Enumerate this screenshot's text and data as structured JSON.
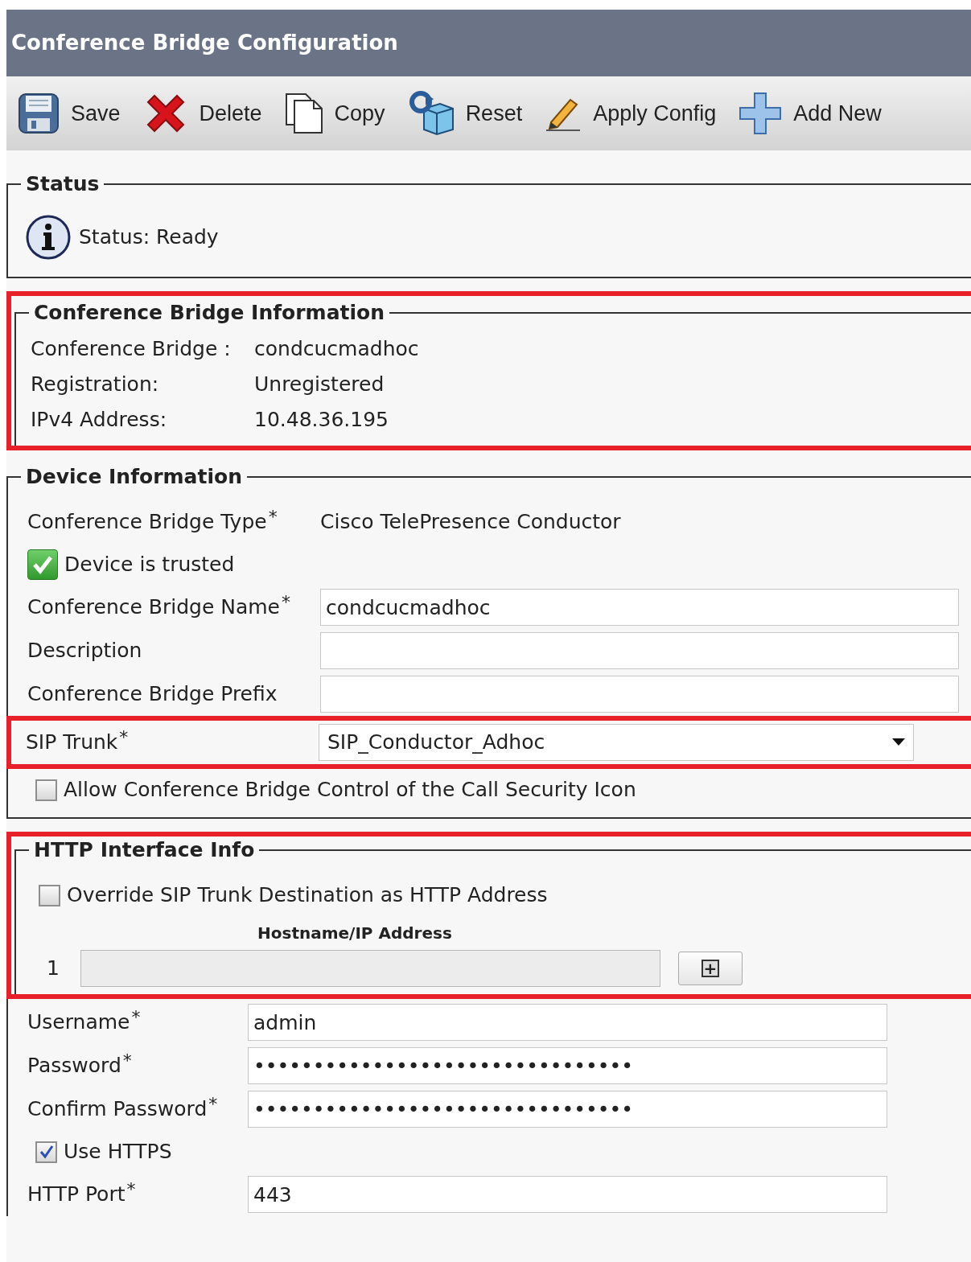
{
  "window": {
    "title": "Conference Bridge Configuration"
  },
  "toolbar": [
    {
      "kind": "save",
      "label": "Save"
    },
    {
      "kind": "delete",
      "label": "Delete"
    },
    {
      "kind": "copy",
      "label": "Copy"
    },
    {
      "kind": "reset",
      "label": "Reset"
    },
    {
      "kind": "apply",
      "label": "Apply Config"
    },
    {
      "kind": "add",
      "label": "Add New"
    }
  ],
  "status": {
    "legend": "Status",
    "text": "Status: Ready"
  },
  "bridge_info": {
    "legend": "Conference Bridge Information",
    "highlighted": true,
    "rows": [
      {
        "label": "Conference Bridge :",
        "value": "condcucmadhoc"
      },
      {
        "label": "Registration:",
        "value": "Unregistered"
      },
      {
        "label": "IPv4 Address:",
        "value": "10.48.36.195"
      }
    ]
  },
  "device_info": {
    "legend": "Device Information",
    "fields": [
      {
        "kind": "static",
        "label": "Conference Bridge Type",
        "required_mark": "*",
        "value": "Cisco TelePresence Conductor"
      },
      {
        "kind": "flag",
        "label": "Device is trusted",
        "checked": true
      },
      {
        "kind": "text",
        "label": "Conference Bridge Name",
        "required_mark": "*",
        "value": "condcucmadhoc"
      },
      {
        "kind": "text",
        "label": "Description"
      },
      {
        "kind": "text",
        "label": "Conference Bridge Prefix"
      },
      {
        "kind": "select",
        "label": "SIP Trunk",
        "required_mark": "*",
        "value": "SIP_Conductor_Adhoc",
        "highlighted": true
      },
      {
        "kind": "checkbox",
        "label": "Allow Conference Bridge Control of the Call Security Icon",
        "checked": false
      }
    ]
  },
  "http_info": {
    "legend": "HTTP Interface Info",
    "highlighted": true,
    "override": {
      "label": "Override SIP Trunk Destination as HTTP Address",
      "checked": false
    },
    "column_header": "Hostname/IP Address",
    "address_rows": [
      {
        "index": "1",
        "disabled": true,
        "button": "+"
      }
    ],
    "fields": [
      {
        "kind": "text",
        "label": "Username",
        "required_mark": "*",
        "value": "admin"
      },
      {
        "kind": "text",
        "label": "Password",
        "required_mark": "*",
        "value": "••••••••••••••••••••••••••••••••"
      },
      {
        "kind": "text",
        "label": "Confirm Password",
        "required_mark": "*",
        "value": "••••••••••••••••••••••••••••••••"
      },
      {
        "kind": "checkbox",
        "label": "Use HTTPS",
        "checked": true
      },
      {
        "kind": "text",
        "label": "HTTP Port",
        "required_mark": "*",
        "value": "443"
      }
    ]
  }
}
